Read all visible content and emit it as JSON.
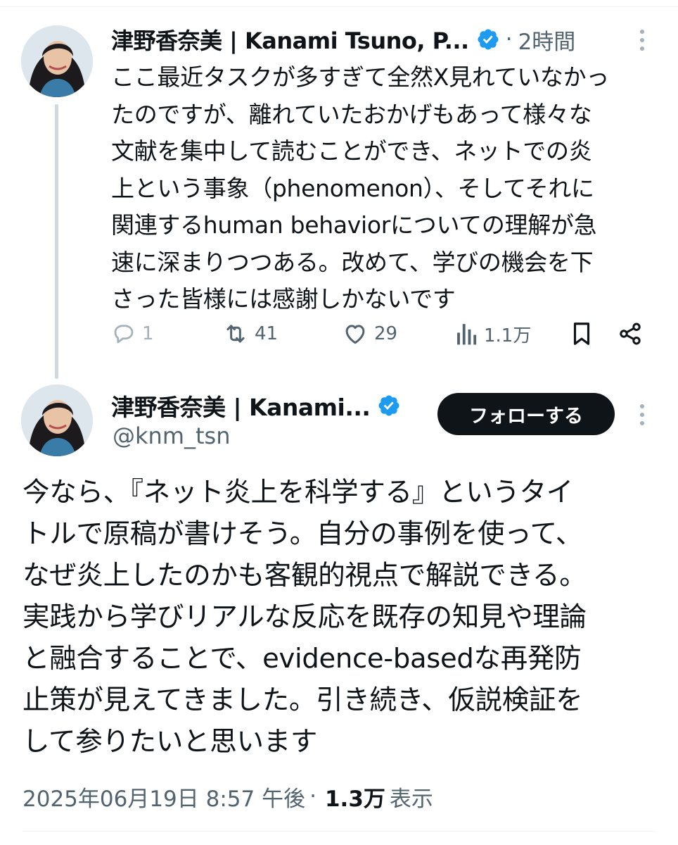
{
  "reply_tweet": {
    "display_name": "津野香奈美 | Kanami Tsuno, P...",
    "time_separator": "·",
    "time_ago": "2時間",
    "lines": [
      "ここ最近タスクが多すぎて全然X見れていなかっ",
      "たのですが、離れていたおかげもあって様々な",
      "文献を集中して読むことができ、ネットでの炎",
      "上という事象（phenomenon）、そしてそれに",
      "関連するhuman behaviorについての理解が急",
      "速に深まりつつある。改めて、学びの機会を下",
      "さった皆様には感謝しかないです"
    ],
    "actions": {
      "reply_count": "1",
      "retweet_count": "41",
      "like_count": "29",
      "view_count": "1.1万"
    }
  },
  "main_tweet": {
    "display_name": "津野香奈美 | Kanami...",
    "handle": "@knm_tsn",
    "follow_label": "フォローする",
    "lines": [
      "今なら、『ネット炎上を科学する』というタイ",
      "トルで原稿が書けそう。自分の事例を使って、",
      "なぜ炎上したのかも客観的視点で解説できる。",
      "実践から学びリアルな反応を既存の知見や理論",
      "と融合することで、evidence-basedな再発防",
      "止策が見えてきました。引き続き、仮説検証を",
      "して参りたいと思います"
    ],
    "timestamp": "2025年06月19日 8:57 午後",
    "separator": "·",
    "views": "1.3万",
    "views_label": "表示"
  },
  "colors": {
    "verified_blue": "#1d9bf0",
    "text_primary": "#0f1419",
    "text_secondary": "#536471",
    "icon_gray": "#536471"
  },
  "icons": {
    "badge": "verified-badge-icon",
    "more": "more-dots-icon",
    "reply": "reply-icon",
    "retweet": "retweet-icon",
    "like": "heart-icon",
    "views": "views-chart-icon",
    "bookmark": "bookmark-icon",
    "share": "share-icon"
  }
}
